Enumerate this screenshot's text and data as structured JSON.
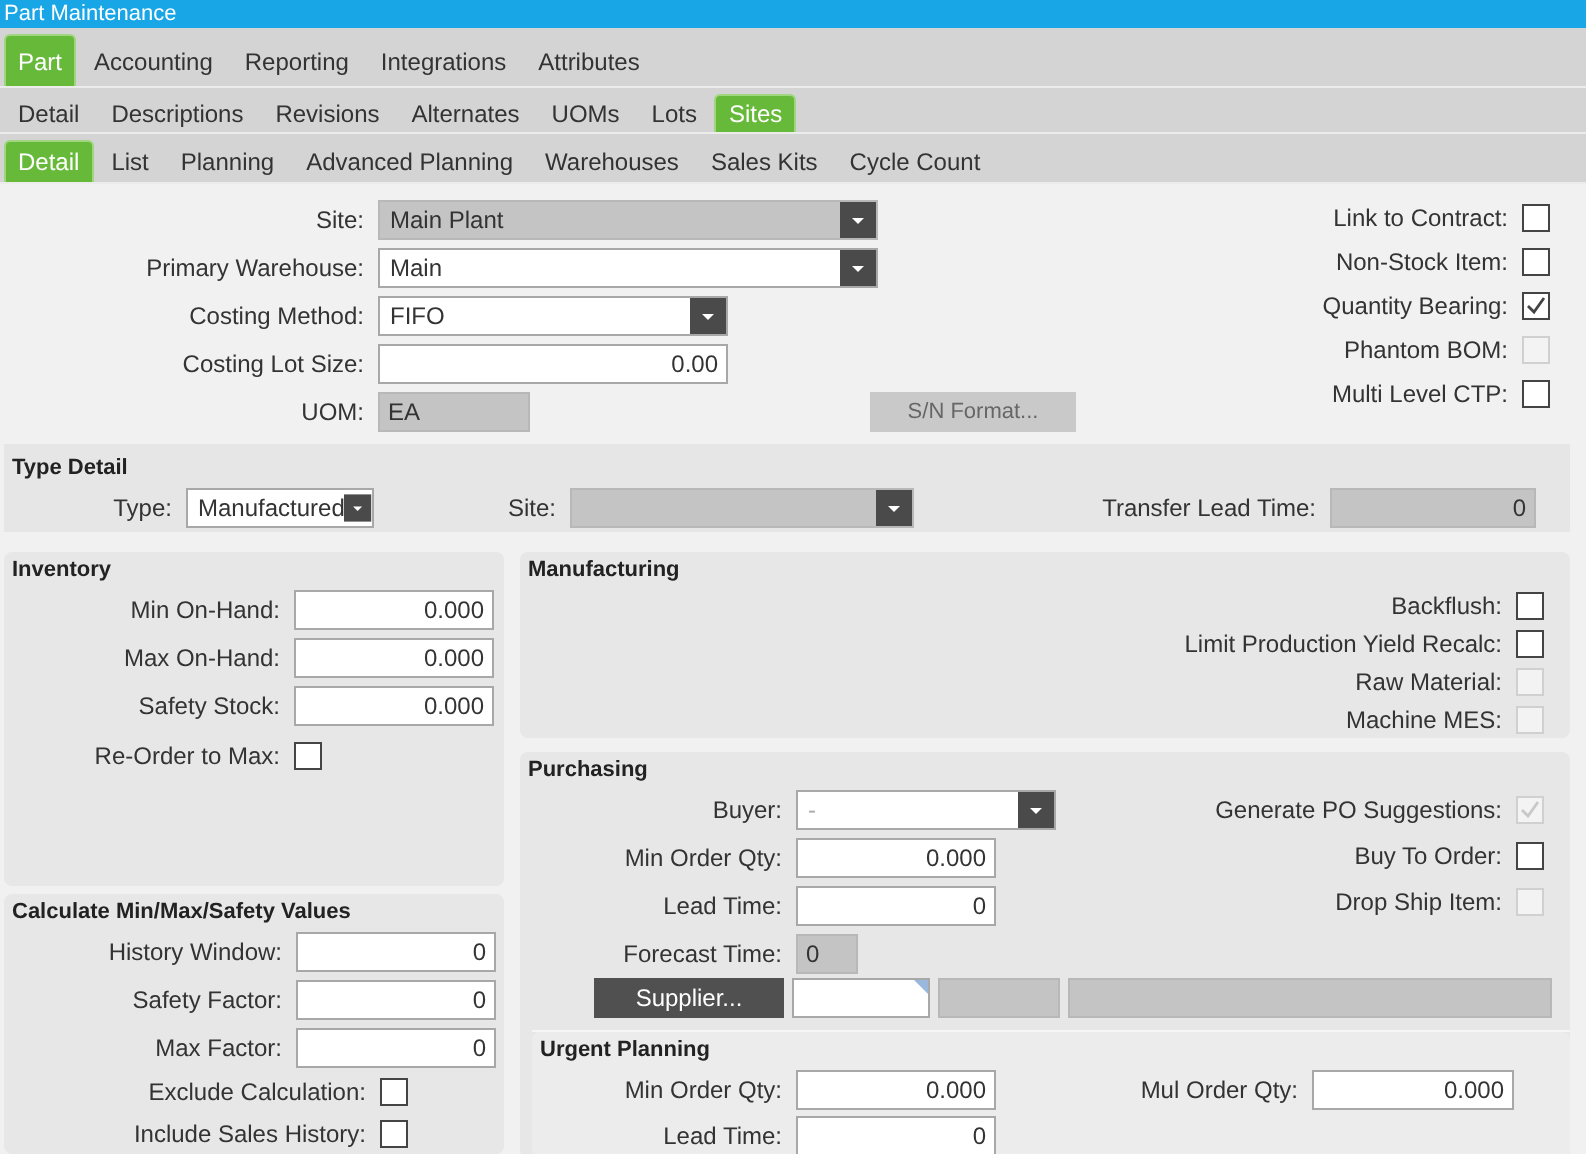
{
  "window": {
    "title": "Part Maintenance"
  },
  "tabs": [
    {
      "label": "Part",
      "selected": true
    },
    {
      "label": "Accounting",
      "selected": false
    },
    {
      "label": "Reporting",
      "selected": false
    },
    {
      "label": "Integrations",
      "selected": false
    },
    {
      "label": "Attributes",
      "selected": false
    }
  ],
  "part_tabs": [
    {
      "label": "Detail",
      "selected": false
    },
    {
      "label": "Descriptions",
      "selected": false
    },
    {
      "label": "Revisions",
      "selected": false
    },
    {
      "label": "Alternates",
      "selected": false
    },
    {
      "label": "UOMs",
      "selected": false
    },
    {
      "label": "Lots",
      "selected": false
    },
    {
      "label": "Sites",
      "selected": true
    }
  ],
  "site_tabs": [
    {
      "label": "Detail",
      "selected": true
    },
    {
      "label": "List",
      "selected": false
    },
    {
      "label": "Planning",
      "selected": false
    },
    {
      "label": "Advanced Planning",
      "selected": false
    },
    {
      "label": "Warehouses",
      "selected": false
    },
    {
      "label": "Sales Kits",
      "selected": false
    },
    {
      "label": "Cycle Count",
      "selected": false
    }
  ],
  "site_detail": {
    "fields": [
      {
        "label": "Site:",
        "kind": "combo",
        "value": "Main Plant",
        "disabled": true
      },
      {
        "label": "Primary Warehouse:",
        "kind": "combo",
        "value": "Main",
        "disabled": false
      },
      {
        "label": "Costing Method:",
        "kind": "combo",
        "value": "FIFO",
        "disabled": false
      },
      {
        "label": "Costing Lot Size:",
        "kind": "number",
        "value": "0.00",
        "disabled": false
      },
      {
        "label": "UOM:",
        "kind": "readonly",
        "value": "EA"
      }
    ],
    "sn_format_button": {
      "label": "S/N Format...",
      "disabled": true
    },
    "checks": [
      {
        "label": "Link to Contract:",
        "checked": false,
        "disabled": false
      },
      {
        "label": "Non-Stock Item:",
        "checked": false,
        "disabled": false
      },
      {
        "label": "Quantity Bearing:",
        "checked": true,
        "disabled": false
      },
      {
        "label": "Phantom BOM:",
        "checked": false,
        "disabled": true
      },
      {
        "label": "Multi Level CTP:",
        "checked": false,
        "disabled": false
      }
    ]
  },
  "type_detail": {
    "title": "Type Detail",
    "fields": [
      {
        "label": "Type:",
        "kind": "combo",
        "value": "Manufactured",
        "disabled": false
      },
      {
        "label": "Site:",
        "kind": "combo",
        "disabled": true
      },
      {
        "label": "Transfer Lead Time:",
        "kind": "number",
        "value": "0",
        "disabled": true
      }
    ]
  },
  "inventory": {
    "title": "Inventory",
    "fields": [
      {
        "label": "Min On-Hand:",
        "kind": "number",
        "value": "0.000",
        "disabled": false
      },
      {
        "label": "Max On-Hand:",
        "kind": "number",
        "value": "0.000",
        "disabled": false
      },
      {
        "label": "Safety Stock:",
        "kind": "number",
        "value": "0.000",
        "disabled": false
      }
    ],
    "checks": [
      {
        "label": "Re-Order to Max:",
        "checked": false,
        "disabled": false
      }
    ]
  },
  "calculate": {
    "title": "Calculate Min/Max/Safety Values",
    "fields": [
      {
        "label": "History Window:",
        "kind": "number",
        "value": "0",
        "disabled": false
      },
      {
        "label": "Safety Factor:",
        "kind": "number",
        "value": "0",
        "disabled": false
      },
      {
        "label": "Max Factor:",
        "kind": "number",
        "value": "0",
        "disabled": false
      }
    ],
    "checks": [
      {
        "label": "Exclude Calculation:",
        "checked": false,
        "disabled": false
      },
      {
        "label": "Include Sales History:",
        "checked": false,
        "disabled": false
      }
    ]
  },
  "manufacturing": {
    "title": "Manufacturing",
    "checks": [
      {
        "label": "Backflush:",
        "checked": false,
        "disabled": false
      },
      {
        "label": "Limit Production Yield Recalc:",
        "checked": false,
        "disabled": false
      },
      {
        "label": "Raw Material:",
        "checked": false,
        "disabled": true
      },
      {
        "label": "Machine MES:",
        "checked": false,
        "disabled": true
      }
    ]
  },
  "purchasing": {
    "title": "Purchasing",
    "fields": [
      {
        "label": "Buyer:",
        "kind": "combo",
        "value": "-",
        "disabled": false
      },
      {
        "label": "Min Order Qty:",
        "kind": "number",
        "value": "0.000",
        "disabled": false
      },
      {
        "label": "Lead Time:",
        "kind": "number",
        "value": "0",
        "disabled": false
      },
      {
        "label": "Forecast Time:",
        "kind": "readonly",
        "value": "0"
      }
    ],
    "checks": [
      {
        "label": "Generate PO Suggestions:",
        "checked": true,
        "disabled": true
      },
      {
        "label": "Buy To Order:",
        "checked": false,
        "disabled": false
      },
      {
        "label": "Drop Ship Item:",
        "checked": false,
        "disabled": true
      }
    ],
    "supplier_button": {
      "label": "Supplier...",
      "disabled": false
    },
    "supplier_fields": [
      {
        "disabled": false
      },
      {
        "disabled": true
      },
      {
        "disabled": true
      }
    ],
    "urgent_planning": {
      "title": "Urgent Planning",
      "fields": [
        {
          "label": "Min Order Qty:",
          "kind": "number",
          "value": "0.000",
          "disabled": false
        },
        {
          "label": "Mul Order Qty:",
          "kind": "number",
          "value": "0.000",
          "disabled": false
        },
        {
          "label": "Lead Time:",
          "kind": "number",
          "value": "0",
          "disabled": false
        }
      ]
    }
  }
}
